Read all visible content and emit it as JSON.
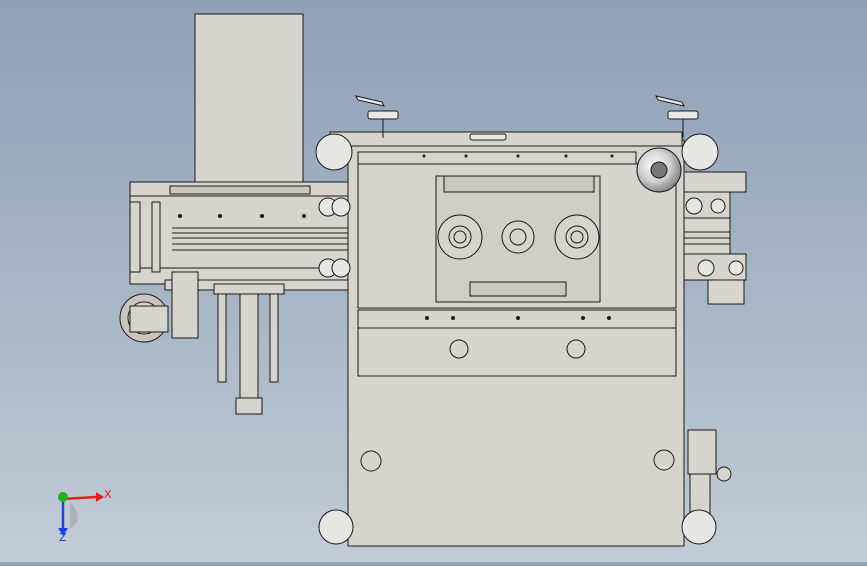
{
  "viewport": {
    "background_top": "#8fa0b7",
    "background_bottom": "#c3ccd6",
    "part_fill": "#d6d4cc",
    "part_edge": "#1a1a1a"
  },
  "triad": {
    "x_label": "X",
    "z_label": "Z",
    "x_color": "#e02020",
    "y_color": "#20b020",
    "z_color": "#2040e0"
  }
}
